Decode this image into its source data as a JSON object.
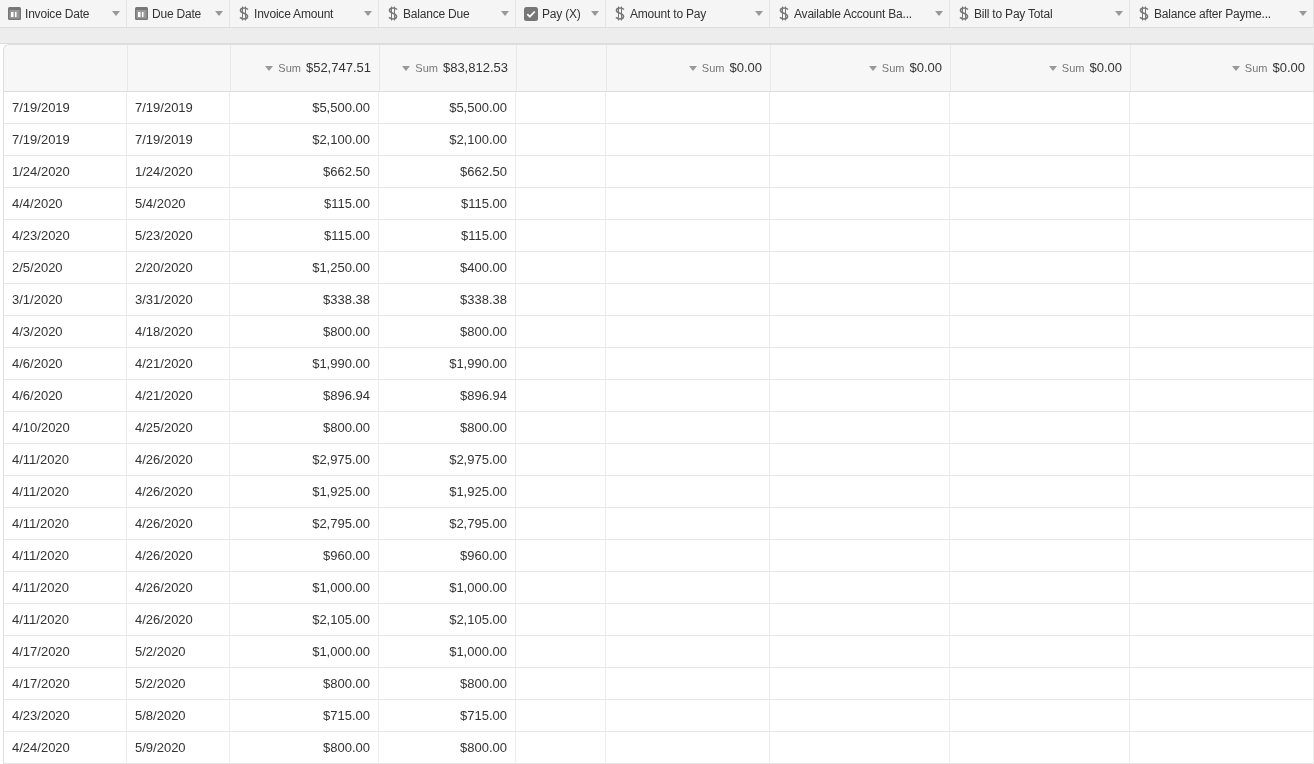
{
  "columns": [
    {
      "kind": "date",
      "label": "Invoice Date"
    },
    {
      "kind": "date",
      "label": "Due Date"
    },
    {
      "kind": "currency",
      "label": "Invoice Amount",
      "summary_label": "Sum",
      "summary": "$52,747.51"
    },
    {
      "kind": "currency",
      "label": "Balance Due",
      "summary_label": "Sum",
      "summary": "$83,812.53"
    },
    {
      "kind": "checkbox",
      "label": "Pay (X)"
    },
    {
      "kind": "currency",
      "label": "Amount to Pay",
      "summary_label": "Sum",
      "summary": "$0.00"
    },
    {
      "kind": "currency",
      "label": "Available Account Ba...",
      "summary_label": "Sum",
      "summary": "$0.00"
    },
    {
      "kind": "currency",
      "label": "Bill to Pay Total",
      "summary_label": "Sum",
      "summary": "$0.00"
    },
    {
      "kind": "currency",
      "label": "Balance after Payme...",
      "summary_label": "Sum",
      "summary": "$0.00"
    }
  ],
  "rows": [
    [
      "7/19/2019",
      "7/19/2019",
      "$5,500.00",
      "$5,500.00"
    ],
    [
      "7/19/2019",
      "7/19/2019",
      "$2,100.00",
      "$2,100.00"
    ],
    [
      "1/24/2020",
      "1/24/2020",
      "$662.50",
      "$662.50"
    ],
    [
      "4/4/2020",
      "5/4/2020",
      "$115.00",
      "$115.00"
    ],
    [
      "4/23/2020",
      "5/23/2020",
      "$115.00",
      "$115.00"
    ],
    [
      "2/5/2020",
      "2/20/2020",
      "$1,250.00",
      "$400.00"
    ],
    [
      "3/1/2020",
      "3/31/2020",
      "$338.38",
      "$338.38"
    ],
    [
      "4/3/2020",
      "4/18/2020",
      "$800.00",
      "$800.00"
    ],
    [
      "4/6/2020",
      "4/21/2020",
      "$1,990.00",
      "$1,990.00"
    ],
    [
      "4/6/2020",
      "4/21/2020",
      "$896.94",
      "$896.94"
    ],
    [
      "4/10/2020",
      "4/25/2020",
      "$800.00",
      "$800.00"
    ],
    [
      "4/11/2020",
      "4/26/2020",
      "$2,975.00",
      "$2,975.00"
    ],
    [
      "4/11/2020",
      "4/26/2020",
      "$1,925.00",
      "$1,925.00"
    ],
    [
      "4/11/2020",
      "4/26/2020",
      "$2,795.00",
      "$2,795.00"
    ],
    [
      "4/11/2020",
      "4/26/2020",
      "$960.00",
      "$960.00"
    ],
    [
      "4/11/2020",
      "4/26/2020",
      "$1,000.00",
      "$1,000.00"
    ],
    [
      "4/11/2020",
      "4/26/2020",
      "$2,105.00",
      "$2,105.00"
    ],
    [
      "4/17/2020",
      "5/2/2020",
      "$1,000.00",
      "$1,000.00"
    ],
    [
      "4/17/2020",
      "5/2/2020",
      "$800.00",
      "$800.00"
    ],
    [
      "4/23/2020",
      "5/8/2020",
      "$715.00",
      "$715.00"
    ],
    [
      "4/24/2020",
      "5/9/2020",
      "$800.00",
      "$800.00"
    ]
  ]
}
